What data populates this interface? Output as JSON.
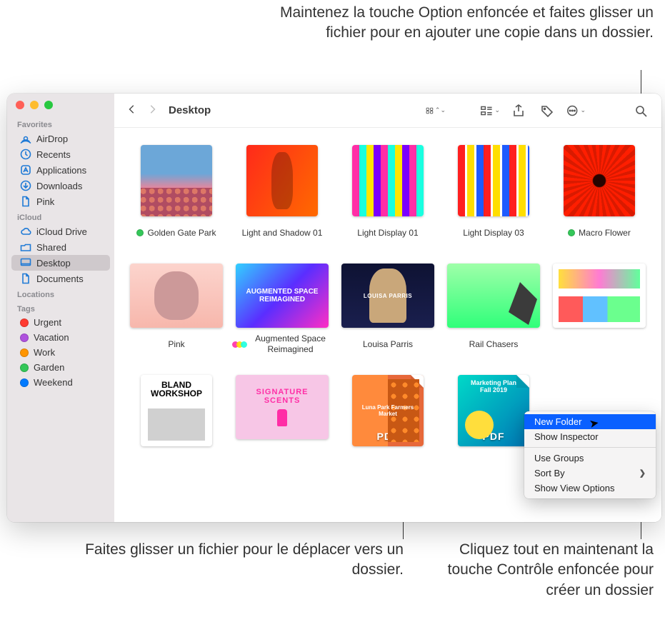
{
  "callouts": {
    "top": "Maintenez la touche Option enfoncée et faites glisser un fichier pour en ajouter une copie dans un dossier.",
    "bottom_left": "Faites glisser un fichier pour le déplacer vers un dossier.",
    "bottom_right": "Cliquez tout en maintenant la touche Contrôle enfoncée pour créer un dossier"
  },
  "toolbar": {
    "location": "Desktop"
  },
  "sidebar": {
    "sections": [
      {
        "header": "Favorites",
        "items": [
          {
            "label": "AirDrop",
            "icon": "airdrop"
          },
          {
            "label": "Recents",
            "icon": "clock"
          },
          {
            "label": "Applications",
            "icon": "app"
          },
          {
            "label": "Downloads",
            "icon": "download"
          },
          {
            "label": "Pink",
            "icon": "doc"
          }
        ]
      },
      {
        "header": "iCloud",
        "items": [
          {
            "label": "iCloud Drive",
            "icon": "cloud"
          },
          {
            "label": "Shared",
            "icon": "shared"
          },
          {
            "label": "Desktop",
            "icon": "desktop",
            "selected": true
          },
          {
            "label": "Documents",
            "icon": "docfolder"
          }
        ]
      },
      {
        "header": "Locations",
        "items": []
      },
      {
        "header": "Tags",
        "items": [
          {
            "label": "Urgent",
            "tag_color": "#ff3b30"
          },
          {
            "label": "Vacation",
            "tag_color": "#af52de"
          },
          {
            "label": "Work",
            "tag_color": "#ff9500"
          },
          {
            "label": "Garden",
            "tag_color": "#34c759"
          },
          {
            "label": "Weekend",
            "tag_color": "#007aff"
          }
        ]
      }
    ]
  },
  "files": [
    {
      "name": "Golden Gate Park",
      "tag_color": "#34c759",
      "thumb": "goldengate"
    },
    {
      "name": "Light and Shadow 01",
      "thumb": "lightshadow"
    },
    {
      "name": "Light Display 01",
      "thumb": "lightdisp1"
    },
    {
      "name": "Light Display 03",
      "thumb": "lightdisp3"
    },
    {
      "name": "Macro Flower",
      "tag_color": "#34c759",
      "thumb": "macro"
    },
    {
      "name": "Pink",
      "thumb": "pink",
      "wide": true
    },
    {
      "name": "Augmented Space Reimagined",
      "thumb": "augmented",
      "wide": true,
      "thumb_text": "AUGMENTED SPACE REIMAGINED",
      "trio": true
    },
    {
      "name": "Louisa Parris",
      "thumb": "louisa",
      "wide": true,
      "thumb_text": "LOUISA PARRIS"
    },
    {
      "name": "Rail Chasers",
      "thumb": "rail",
      "wide": true
    },
    {
      "name": "",
      "thumb": "presentation",
      "wide": true
    },
    {
      "name": "",
      "thumb": "bland",
      "thumb_text": "BLAND WORKSHOP"
    },
    {
      "name": "",
      "thumb": "scents",
      "wide": true,
      "thumb_text": "SIGNATURE SCENTS"
    },
    {
      "name": "",
      "thumb": "lunapark",
      "pdf": true,
      "thumb_text": "Luna Park Farmers Market"
    },
    {
      "name": "",
      "thumb": "marketing",
      "pdf": true,
      "thumb_text": "Marketing Plan Fall 2019"
    }
  ],
  "context_menu": {
    "items": [
      {
        "label": "New Folder",
        "highlighted": true
      },
      {
        "label": "Show Inspector"
      },
      {
        "separator": true
      },
      {
        "label": "Use Groups"
      },
      {
        "label": "Sort By",
        "submenu": true
      },
      {
        "label": "Show View Options"
      }
    ]
  }
}
